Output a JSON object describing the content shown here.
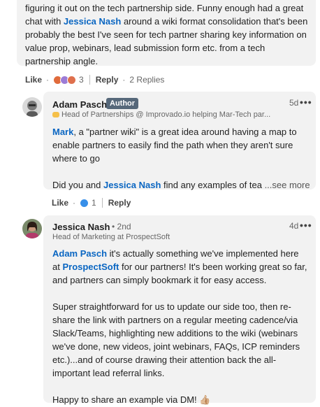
{
  "top_comment": {
    "text_parts": {
      "a": "figuring it out on the tech partnership side. Funny enough had a great chat with ",
      "mention": "Jessica Nash",
      "b": " around a wiki format consolidation that's been probably the best I've seen for tech partner sharing key information on value prop, webinars, lead submission form etc. from a tech partnership angle."
    },
    "actions": {
      "like": "Like",
      "reaction_count": "3",
      "reply": "Reply",
      "replies": "2 Replies"
    }
  },
  "adam_reply": {
    "name": "Adam Pasch",
    "badge": "Author",
    "headline": "Head of Partnerships @ Improvado.io helping Mar-Tech par...",
    "time": "5d",
    "more": "•••",
    "p1_mention": "Mark",
    "p1_text": ", a \"partner wiki\" is a great idea around having a map to enable partners to easily find the path when they aren't sure where to go",
    "p2_a": "Did you and ",
    "p2_mention": "Jessica Nash",
    "p2_b": " find any examples of tea",
    "see_more": "...see more",
    "actions": {
      "like": "Like",
      "reaction_count": "1",
      "reply": "Reply"
    }
  },
  "jessica_reply": {
    "name": "Jessica Nash",
    "degree": "• 2nd",
    "headline": "Head of Marketing at ProspectSoft",
    "time": "4d",
    "more": "•••",
    "p1_mention_a": "Adam Pasch",
    "p1_a": " it's actually something we've implemented here at ",
    "p1_mention_b": "ProspectSoft",
    "p1_b": " for our partners! It's been working great so far, and partners can simply bookmark it for easy access.",
    "p2": "Super straightforward for us to update our side too, then re-share the link with partners on a regular meeting cadence/via Slack/Teams, highlighting new additions to the wiki (webinars we've done, new videos, joint webinars, FAQs, ICP reminders etc.)...and of course drawing their attention back the all-important lead referral links.",
    "p3": "Happy to share an example via DM! 👍🏼"
  },
  "colors": {
    "link": "#0a66c2",
    "bubble": "#f2f2f2",
    "badge": "#56687a"
  }
}
